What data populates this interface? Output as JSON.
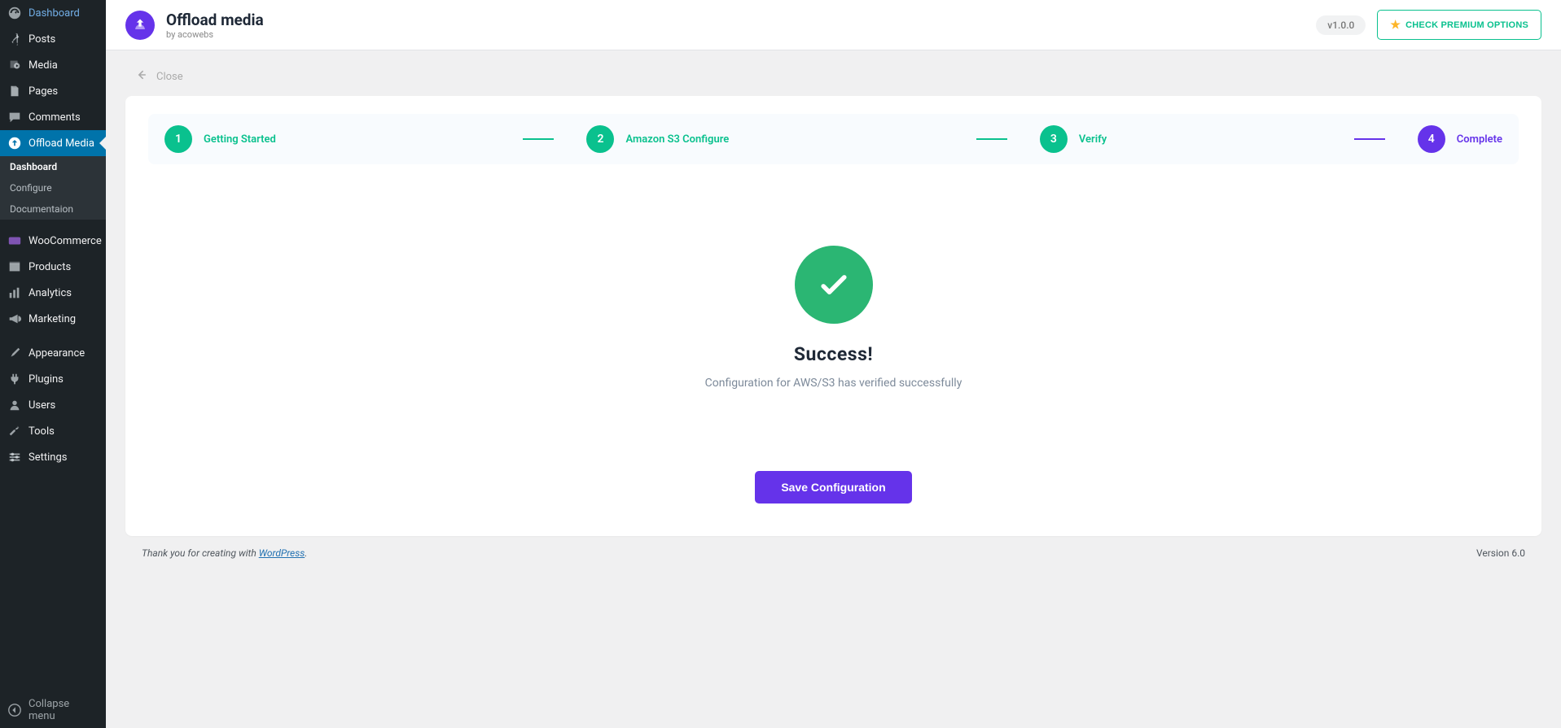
{
  "sidebar": {
    "items": [
      {
        "label": "Dashboard",
        "icon": "gauge"
      },
      {
        "label": "Posts",
        "icon": "pin"
      },
      {
        "label": "Media",
        "icon": "media"
      },
      {
        "label": "Pages",
        "icon": "page"
      },
      {
        "label": "Comments",
        "icon": "comment"
      },
      {
        "label": "Offload Media",
        "icon": "upload"
      },
      {
        "label": "WooCommerce",
        "icon": "woo"
      },
      {
        "label": "Products",
        "icon": "products"
      },
      {
        "label": "Analytics",
        "icon": "analytics"
      },
      {
        "label": "Marketing",
        "icon": "megaphone"
      },
      {
        "label": "Appearance",
        "icon": "brush"
      },
      {
        "label": "Plugins",
        "icon": "plug"
      },
      {
        "label": "Users",
        "icon": "users"
      },
      {
        "label": "Tools",
        "icon": "wrench"
      },
      {
        "label": "Settings",
        "icon": "settings"
      },
      {
        "label": "Collapse menu",
        "icon": "collapse"
      }
    ],
    "sub": {
      "dashboard": "Dashboard",
      "configure": "Configure",
      "documentation": "Documentaion"
    }
  },
  "topbar": {
    "title": "Offload media",
    "subtitle": "by acowebs",
    "version": "v1.0.0",
    "premium": "CHECK PREMIUM OPTIONS"
  },
  "close_label": "Close",
  "stepper": {
    "s1": {
      "num": "1",
      "label": "Getting Started"
    },
    "s2": {
      "num": "2",
      "label": "Amazon S3 Configure"
    },
    "s3": {
      "num": "3",
      "label": "Verify"
    },
    "s4": {
      "num": "4",
      "label": "Complete"
    }
  },
  "success": {
    "title": "Success!",
    "subtitle": "Configuration for AWS/S3 has verified successfully",
    "button": "Save Configuration"
  },
  "footer": {
    "thank_pre": "Thank you for creating with ",
    "link": "WordPress",
    "version": "Version 6.0"
  }
}
